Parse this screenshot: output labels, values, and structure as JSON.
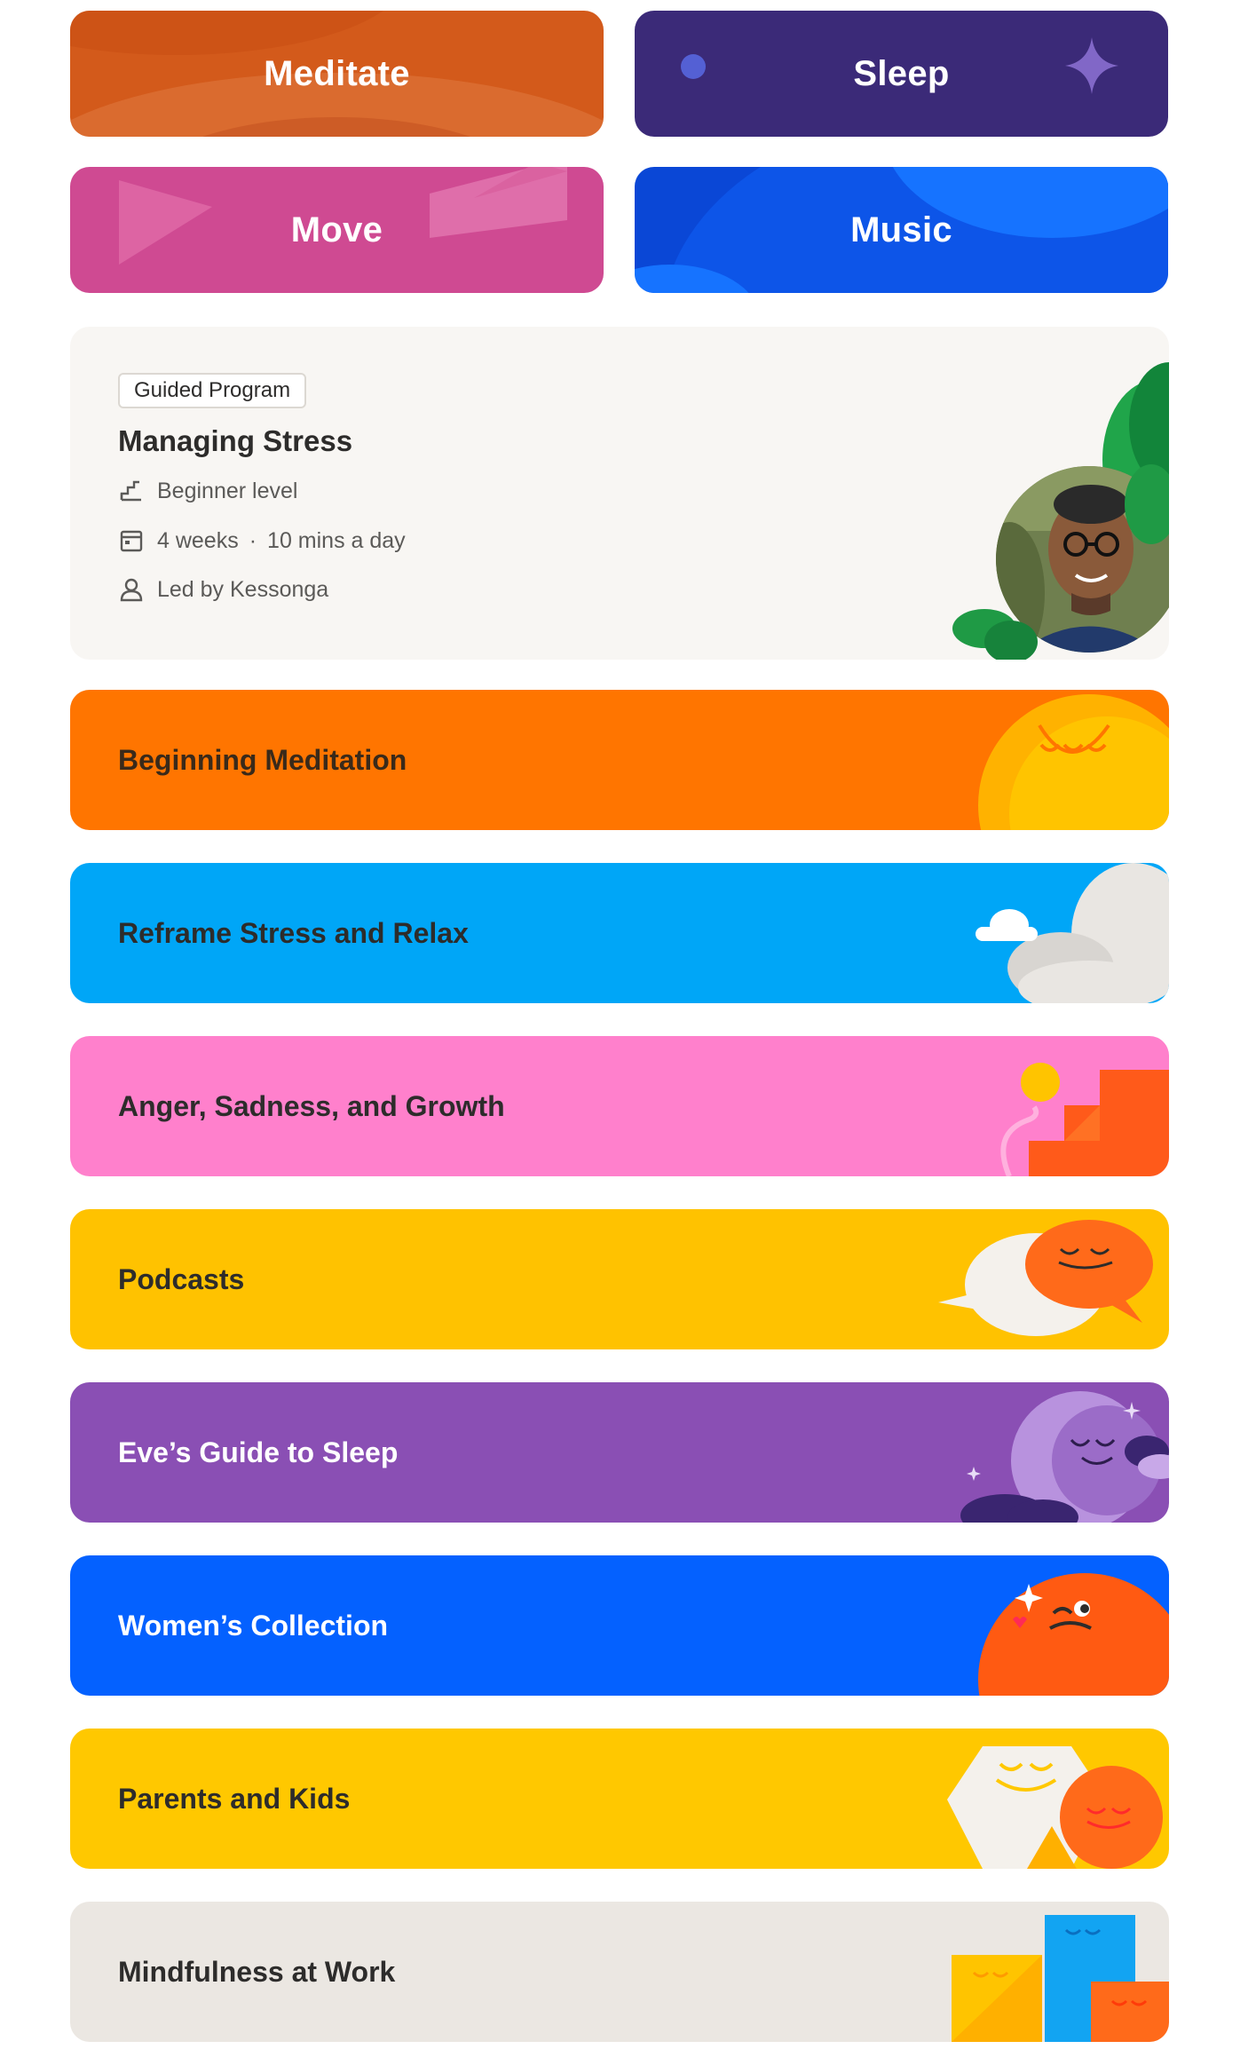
{
  "tiles": {
    "meditate": {
      "label": "Meditate",
      "color": "#d35a1b"
    },
    "sleep": {
      "label": "Sleep",
      "color": "#3b2a78"
    },
    "move": {
      "label": "Move",
      "color": "#cf4a92"
    },
    "music": {
      "label": "Music",
      "color": "#0a47d6"
    }
  },
  "program": {
    "badge": "Guided Program",
    "title": "Managing Stress",
    "level": "Beginner level",
    "duration_weeks": "4 weeks",
    "duration_daily": "10 mins a day",
    "separator": "·",
    "leader": "Led by Kessonga"
  },
  "collections": [
    {
      "label": "Beginning Meditation",
      "color": "#ff7500",
      "text_color": "#3a2a1a"
    },
    {
      "label": "Reframe Stress and Relax",
      "color": "#00a6f7",
      "text_color": "#2d2c2b"
    },
    {
      "label": "Anger, Sadness, and Growth",
      "color": "#ff80cc",
      "text_color": "#2d2c2b"
    },
    {
      "label": "Podcasts",
      "color": "#ffc200",
      "text_color": "#2d2c2b"
    },
    {
      "label": "Eve’s Guide to Sleep",
      "color": "#8a4fb4",
      "text_color": "#ffffff"
    },
    {
      "label": "Women’s Collection",
      "color": "#0461ff",
      "text_color": "#ffffff"
    },
    {
      "label": "Parents and Kids",
      "color": "#ffc800",
      "text_color": "#2d2c2b"
    },
    {
      "label": "Mindfulness at Work",
      "color": "#ebe7e2",
      "text_color": "#2d2c2b"
    }
  ]
}
